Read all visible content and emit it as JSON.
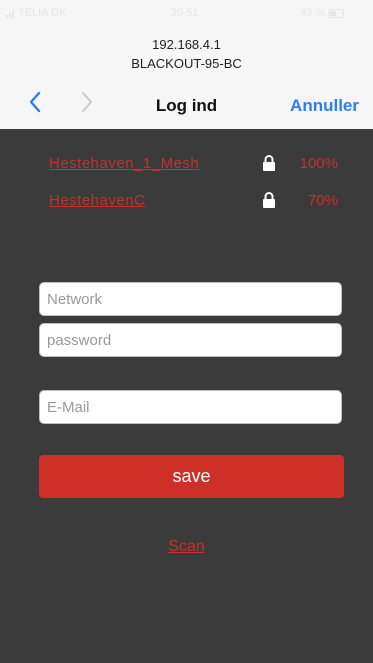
{
  "status_bar": {
    "carrier": "TELIA DK",
    "time": "20.51",
    "battery": "43 %"
  },
  "header": {
    "ip": "192.168.4.1",
    "ssid": "BLACKOUT-95-BC"
  },
  "nav": {
    "title": "Log ind",
    "cancel_label": "Annuller"
  },
  "networks": [
    {
      "name": "Hestehaven_1_Mesh",
      "signal": "100%"
    },
    {
      "name": "HestehavenC",
      "signal": "70%"
    }
  ],
  "form": {
    "network_placeholder": "Network",
    "password_placeholder": "password",
    "email_placeholder": "E-Mail",
    "save_label": "save"
  },
  "scan_label": "Scan",
  "colors": {
    "accent_red": "#cc3027",
    "link_red": "#c5312a",
    "ios_blue": "#2d7ef2",
    "background": "#3b3b3b"
  }
}
